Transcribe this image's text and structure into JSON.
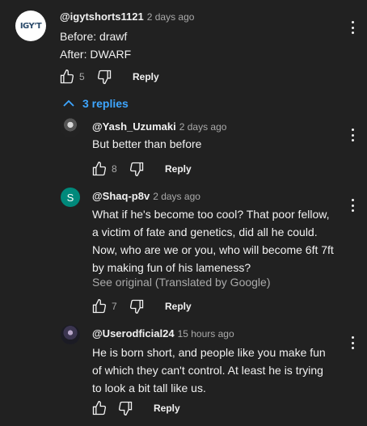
{
  "comments": [
    {
      "handle": "@igytshorts1121",
      "time": "2 days ago",
      "lines": [
        "Before: drawf",
        "After: DWARF"
      ],
      "likes": "5",
      "reply": "Reply",
      "avatar_text": "IGY'T"
    }
  ],
  "replies_toggle": "3 replies",
  "replies": [
    {
      "handle": "@Yash_Uzumaki",
      "time": "2 days ago",
      "lines": [
        "But better than before"
      ],
      "likes": "8",
      "reply": "Reply"
    },
    {
      "handle": "@Shaq-p8v",
      "time": "2 days ago",
      "lines": [
        "What if he's become too cool? That poor fellow,",
        "a victim of fate and genetics, did all he could.",
        "Now, who are we or you, who will become 6ft 7ft",
        "by making fun of his lameness?"
      ],
      "see_original": "See original (Translated by Google)",
      "likes": "7",
      "reply": "Reply",
      "avatar_letter": "S",
      "avatar_color": "#00897b"
    },
    {
      "handle": "@Userodficial24",
      "time": "15 hours ago",
      "lines": [
        "He is born short, and people like you make fun",
        "of which they can't control. At least he is trying",
        "to look a bit tall like us."
      ],
      "likes": "",
      "reply": "Reply"
    }
  ],
  "colors": {
    "background": "#212121",
    "text": "#f1f1f1",
    "secondary": "#aaaaaa",
    "link": "#3ea6ff"
  }
}
